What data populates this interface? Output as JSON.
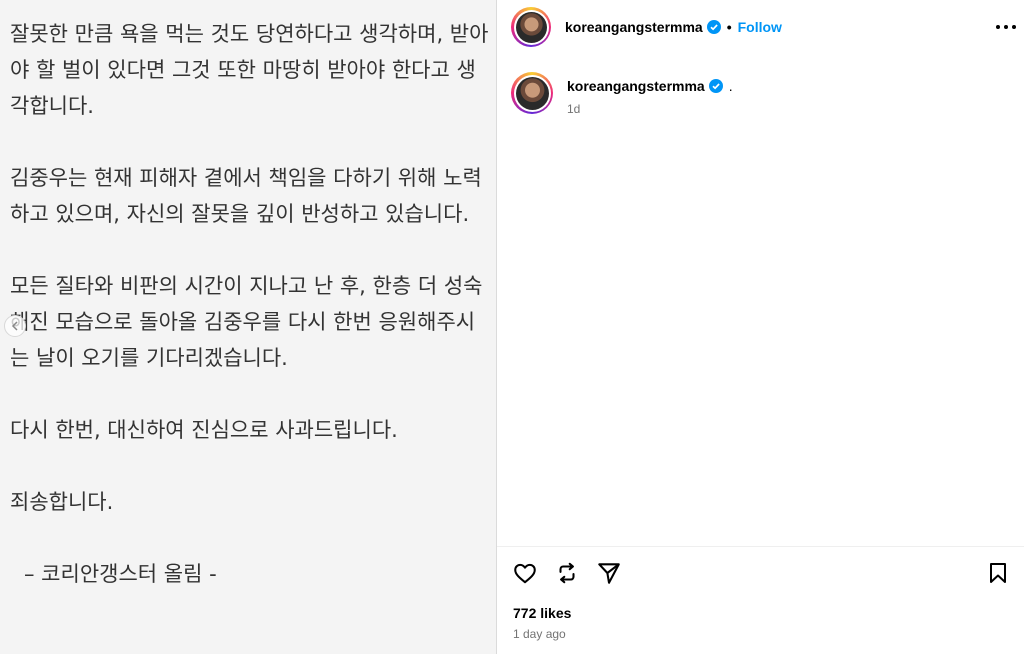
{
  "post": {
    "paragraphs": [
      "잘못한 만큼 욕을 먹는 것도 당연하다고 생각하며, 받아야 할 벌이 있다면 그것 또한 마땅히 받아야 한다고 생각합니다.",
      "김중우는 현재 피해자 곁에서 책임을 다하기 위해 노력하고 있으며, 자신의 잘못을 깊이 반성하고 있습니다.",
      "모든 질타와 비판의 시간이 지나고 난 후, 한층 더 성숙해진 모습으로 돌아올 김중우를 다시 한번 응원해주시는 날이 오기를 기다리겠습니다.",
      "다시 한번, 대신하여 진심으로 사과드립니다.",
      "죄송합니다."
    ],
    "signature": "–  코리안갱스터 올림 -"
  },
  "header": {
    "username": "koreangangstermma",
    "separator": "•",
    "follow_label": "Follow",
    "more_icon": "more-horizontal-icon"
  },
  "comment": {
    "username": "koreangangstermma",
    "caption": ".",
    "time": "1d"
  },
  "actions": {
    "like_icon": "heart-icon",
    "repost_icon": "repost-icon",
    "share_icon": "send-icon",
    "save_icon": "bookmark-icon"
  },
  "stats": {
    "likes": "772 likes",
    "posted": "1 day ago"
  },
  "colors": {
    "accent": "#0095f6",
    "verified": "#0095f6",
    "muted": "#737373"
  }
}
